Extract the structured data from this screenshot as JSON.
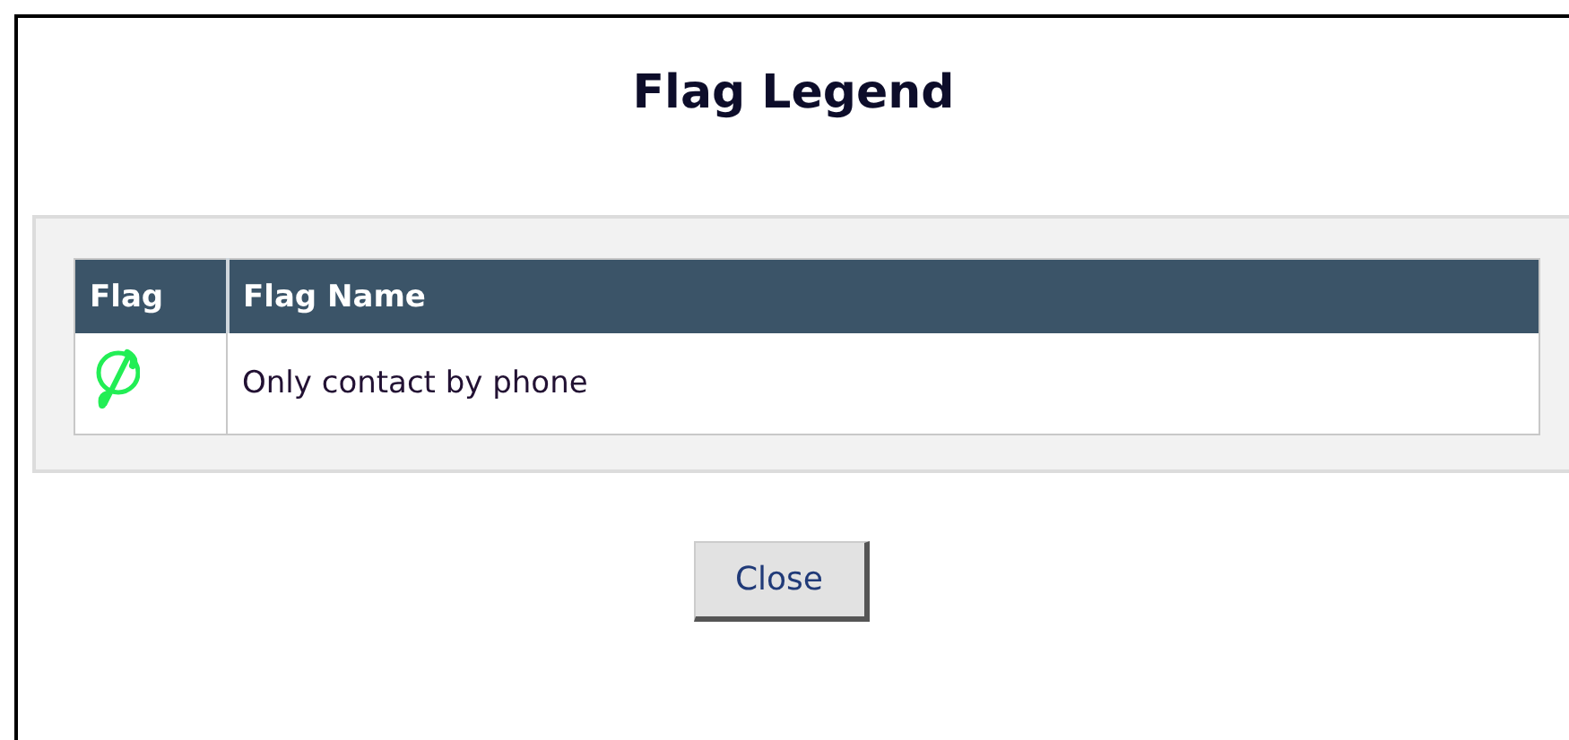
{
  "title": "Flag Legend",
  "table": {
    "columns": [
      "Flag",
      "Flag Name"
    ],
    "rows": [
      {
        "flag_name": "Only contact by phone"
      }
    ]
  },
  "buttons": [
    "Close"
  ]
}
